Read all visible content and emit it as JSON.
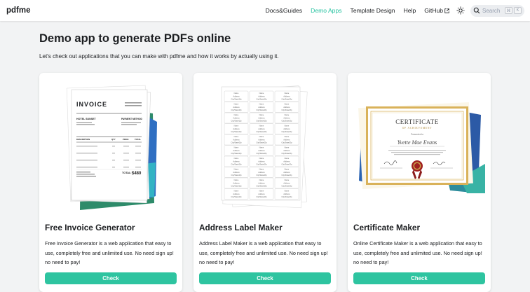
{
  "brand": "pdfme",
  "nav": {
    "links": [
      {
        "label": "Docs&Guides",
        "active": false
      },
      {
        "label": "Demo Apps",
        "active": true
      },
      {
        "label": "Template Design",
        "active": false
      },
      {
        "label": "Help",
        "active": false
      },
      {
        "label": "GitHub",
        "active": false
      }
    ],
    "theme_icon": "sun-icon",
    "search": {
      "label": "Search",
      "keys": [
        "⌘",
        "K"
      ]
    }
  },
  "page": {
    "title": "Demo app to generate PDFs online",
    "subtitle": "Let's check out applications that you can make with pdfme and how it works by actually using it."
  },
  "cards": [
    {
      "title": "Free Invoice Generator",
      "description": "Free Invoice Generator is a web application that easy to use, completely free and unlimited use. No need sign up! no need to pay!",
      "button": "Check",
      "preview": {
        "heading": "INVOICE",
        "company": "HOTEL SUNSET",
        "payment": "PAYMENT METHOD",
        "columns": [
          "DESCRIPTION",
          "QTY",
          "PRICE",
          "TOTAL"
        ],
        "total_label": "TOTAL:",
        "total_value": "$480"
      }
    },
    {
      "title": "Address Label Maker",
      "description": "Address Label Maker is a web application that easy to use, completely free and unlimited use. No need sign up! no need to pay!",
      "button": "Check",
      "preview": {
        "label_lines": [
          "Name",
          "Address",
          "City/State/Zip"
        ]
      }
    },
    {
      "title": "Certificate Maker",
      "description": "Online Certificate Maker is a web application that easy to use, completely free and unlimited use. No need sign up! no need to pay!",
      "button": "Check",
      "preview": {
        "heading": "CERTIFICATE",
        "subheading": "OF ACHIEVEMENT",
        "presented": "Presented to",
        "name": "Yvette Mae Evans"
      }
    }
  ],
  "colors": {
    "accent": "#25c2a0",
    "button": "#2ec4a0"
  }
}
